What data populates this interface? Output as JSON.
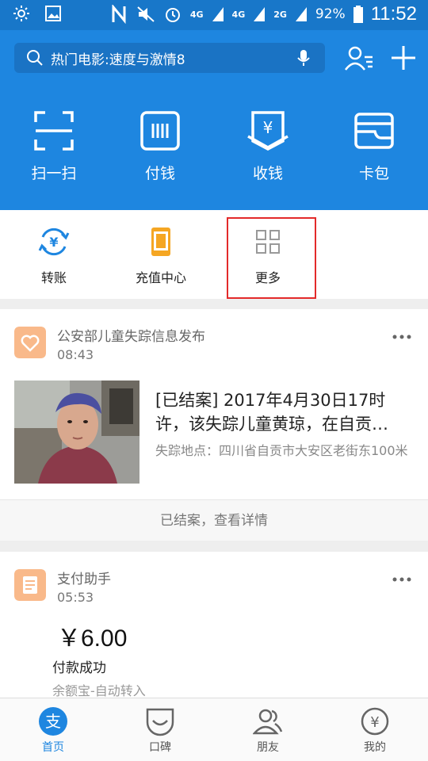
{
  "status_bar": {
    "network_a": "4G",
    "network_b": "4G",
    "network_c": "2G",
    "battery": "92%",
    "time": "11:52"
  },
  "header": {
    "search_placeholder": "热门电影:速度与激情8",
    "quick_actions": [
      {
        "label": "扫一扫",
        "icon": "scan-icon"
      },
      {
        "label": "付钱",
        "icon": "pay-code-icon"
      },
      {
        "label": "收钱",
        "icon": "receive-money-icon"
      },
      {
        "label": "卡包",
        "icon": "card-wallet-icon"
      }
    ]
  },
  "services": [
    {
      "label": "转账",
      "icon": "transfer-icon"
    },
    {
      "label": "充值中心",
      "icon": "phone-recharge-icon"
    },
    {
      "label": "更多",
      "icon": "more-grid-icon"
    }
  ],
  "feed": {
    "card1": {
      "source": "公安部儿童失踪信息发布",
      "time": "08:43",
      "title": "[已结案] 2017年4月30日17时许，该失踪儿童黄琼，在自贡…",
      "location": "失踪地点：四川省自贡市大安区老街东100米",
      "footer": "已结案，查看详情"
    },
    "card2": {
      "source": "支付助手",
      "time": "05:53",
      "amount": "￥6.00",
      "status": "付款成功",
      "detail": "余额宝-自动转入"
    }
  },
  "tabbar": [
    {
      "label": "首页",
      "icon": "home-alipay-icon",
      "active": true
    },
    {
      "label": "口碑",
      "icon": "koubei-icon",
      "active": false
    },
    {
      "label": "朋友",
      "icon": "friends-icon",
      "active": false
    },
    {
      "label": "我的",
      "icon": "profile-yuan-icon",
      "active": false
    }
  ],
  "colors": {
    "primary_blue": "#1e86e0",
    "highlight_red": "#e32a2a",
    "card_orange": "#f9b98a"
  }
}
